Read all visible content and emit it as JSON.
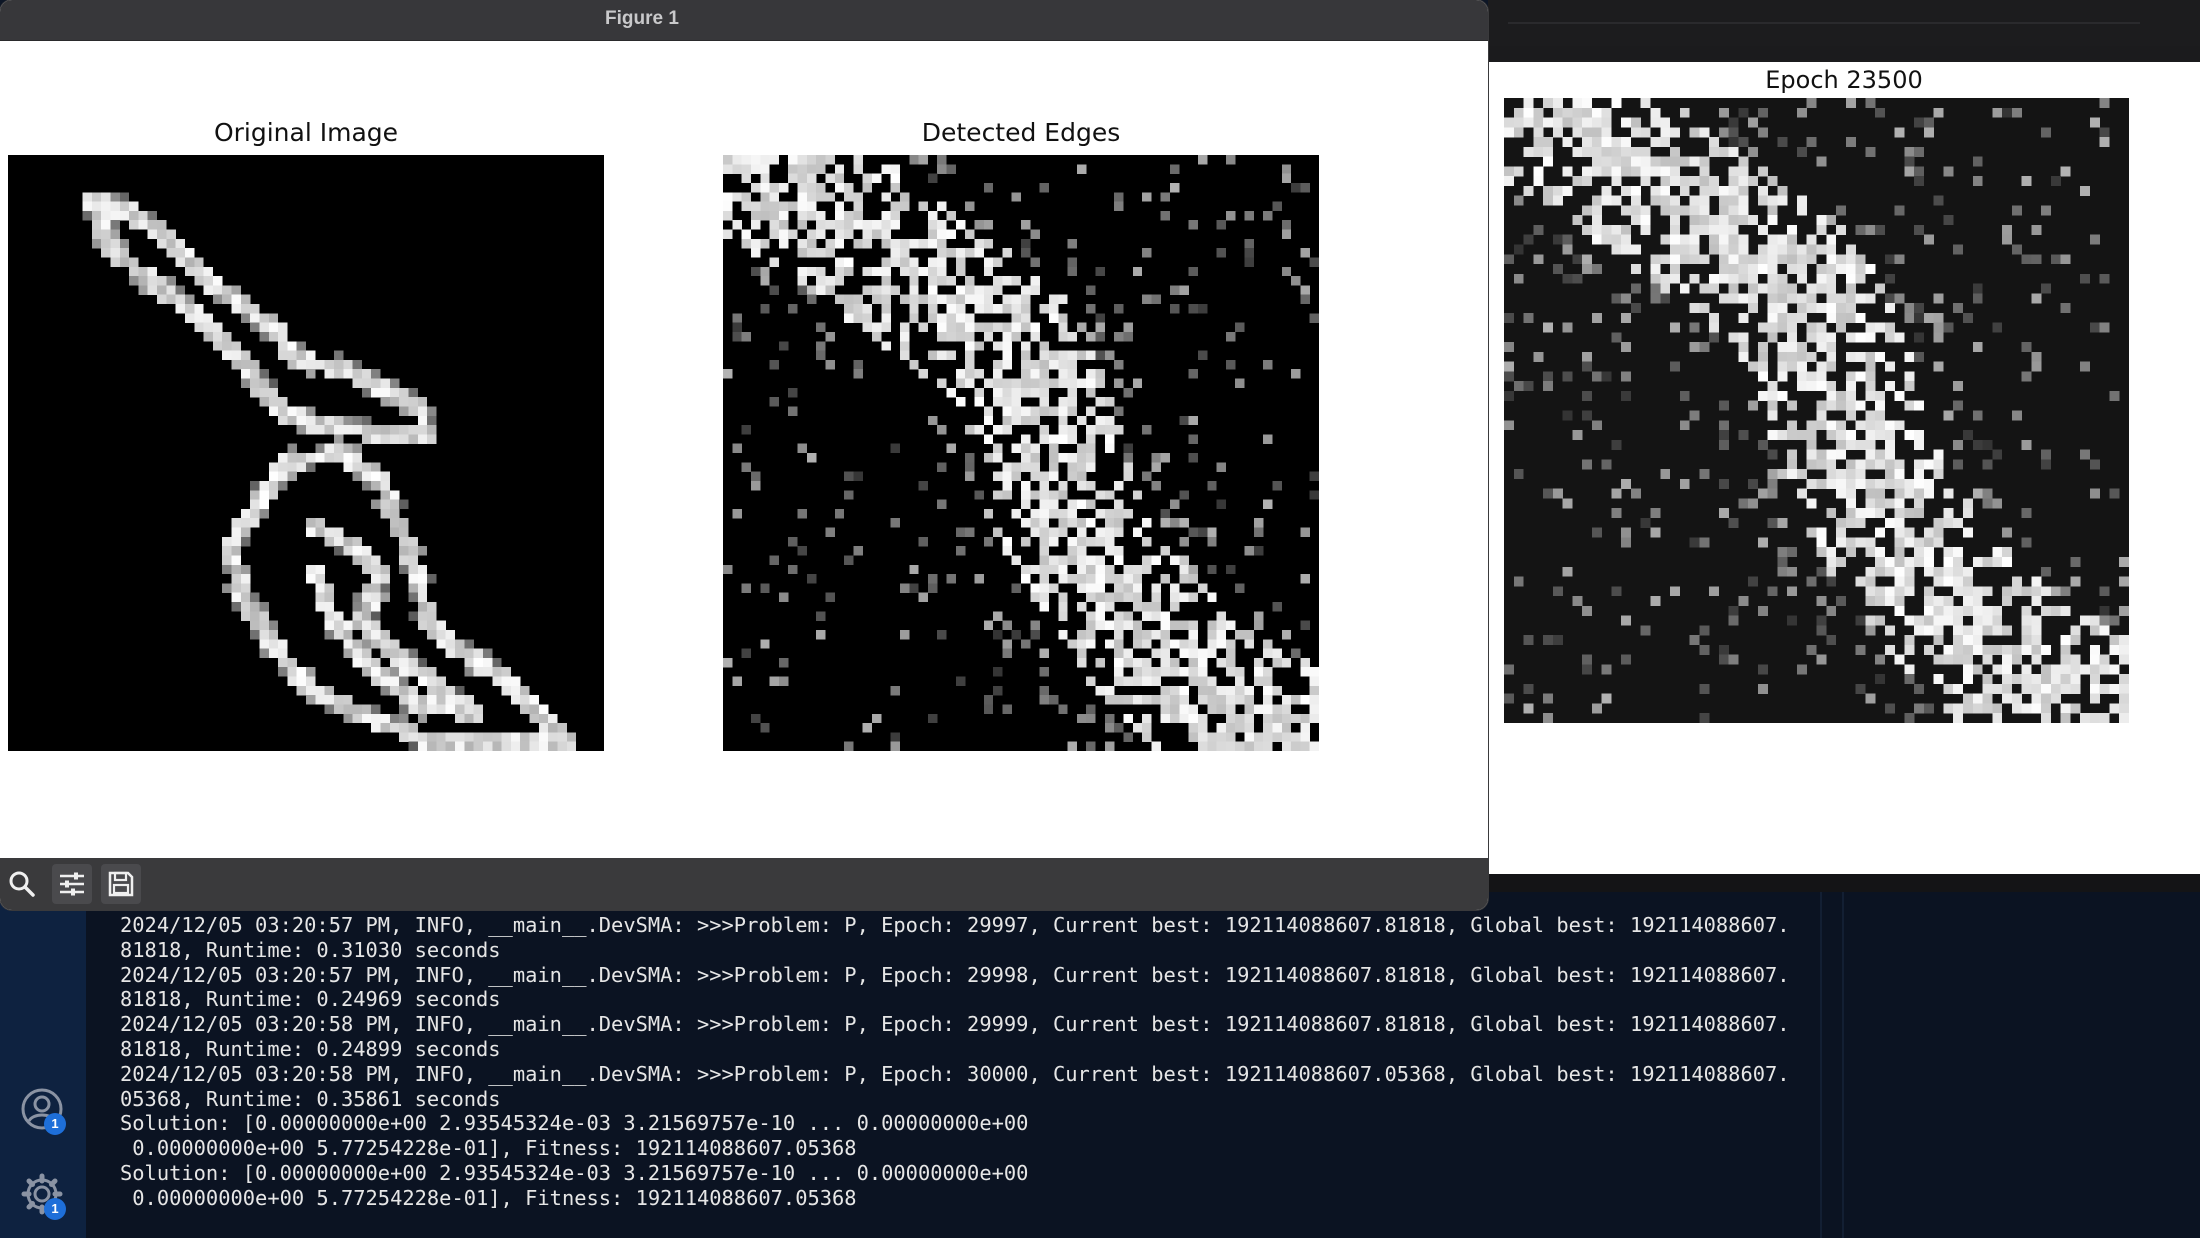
{
  "figure_window": {
    "title": "Figure 1",
    "plots": [
      {
        "title": "Original Image",
        "kind": "outline"
      },
      {
        "title": "Detected Edges",
        "kind": "noisy-edges"
      }
    ],
    "toolbar": {
      "icons": [
        "search-icon",
        "sliders-icon",
        "save-icon"
      ]
    }
  },
  "epoch_window": {
    "plot_title": "Epoch 23500"
  },
  "terminal": {
    "lines": [
      "2024/12/05 03:20:57 PM, INFO, __main__.DevSMA: >>>Problem: P, Epoch: 29997, Current best: 192114088607.81818, Global best: 192114088607.",
      "81818, Runtime: 0.31030 seconds",
      "2024/12/05 03:20:57 PM, INFO, __main__.DevSMA: >>>Problem: P, Epoch: 29998, Current best: 192114088607.81818, Global best: 192114088607.",
      "81818, Runtime: 0.24969 seconds",
      "2024/12/05 03:20:58 PM, INFO, __main__.DevSMA: >>>Problem: P, Epoch: 29999, Current best: 192114088607.81818, Global best: 192114088607.",
      "81818, Runtime: 0.24899 seconds",
      "2024/12/05 03:20:58 PM, INFO, __main__.DevSMA: >>>Problem: P, Epoch: 30000, Current best: 192114088607.05368, Global best: 192114088607.",
      "05368, Runtime: 0.35861 seconds",
      "Solution: [0.00000000e+00 2.93545324e-03 3.21569757e-10 ... 0.00000000e+00",
      " 0.00000000e+00 5.77254228e-01], Fitness: 192114088607.05368",
      "Solution: [0.00000000e+00 2.93545324e-03 3.21569757e-10 ... 0.00000000e+00",
      " 0.00000000e+00 5.77254228e-01], Fitness: 192114088607.05368"
    ]
  },
  "sidebar": {
    "accounts_badge": "1",
    "settings_badge": "1"
  },
  "colors": {
    "terminal_bg": "#0b1322",
    "terminal_text": "#e6e6e6",
    "badge": "#1e6fd9"
  }
}
